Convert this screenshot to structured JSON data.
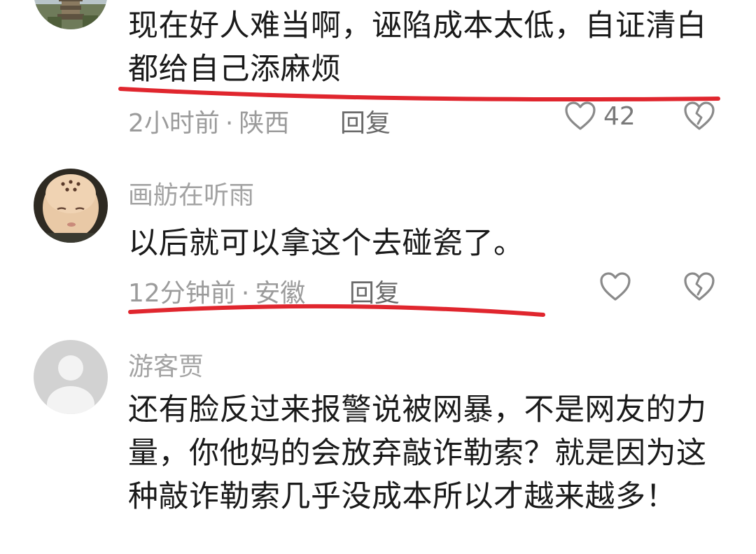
{
  "comments": [
    {
      "username": "",
      "text": "现在好人难当啊，诬陷成本太低，自证清白都给自己添麻烦",
      "time": "2小时前",
      "location": "陕西",
      "reply_label": "回复",
      "likes": "42",
      "avatar": "pagoda-photo-avatar"
    },
    {
      "username": "画舫在听雨",
      "text": "以后就可以拿这个去碰瓷了。",
      "time": "12分钟前",
      "location": "安徽",
      "reply_label": "回复",
      "likes": "",
      "avatar": "baby-photo-avatar"
    },
    {
      "username": "游客贾",
      "text": "还有脸反过来报警说被网暴，不是网友的力量，你他妈的会放弃敲诈勒索？就是因为这种敲诈勒索几乎没成本所以才越来越多！",
      "time": "",
      "location": "",
      "reply_label": "",
      "likes": "",
      "avatar": "default-user-avatar"
    }
  ],
  "separator": "·",
  "colors": {
    "underline": "#e0262e",
    "meta_text": "#9b9b9b",
    "username": "#a3a3a3",
    "body_text": "#1a1a1a"
  }
}
